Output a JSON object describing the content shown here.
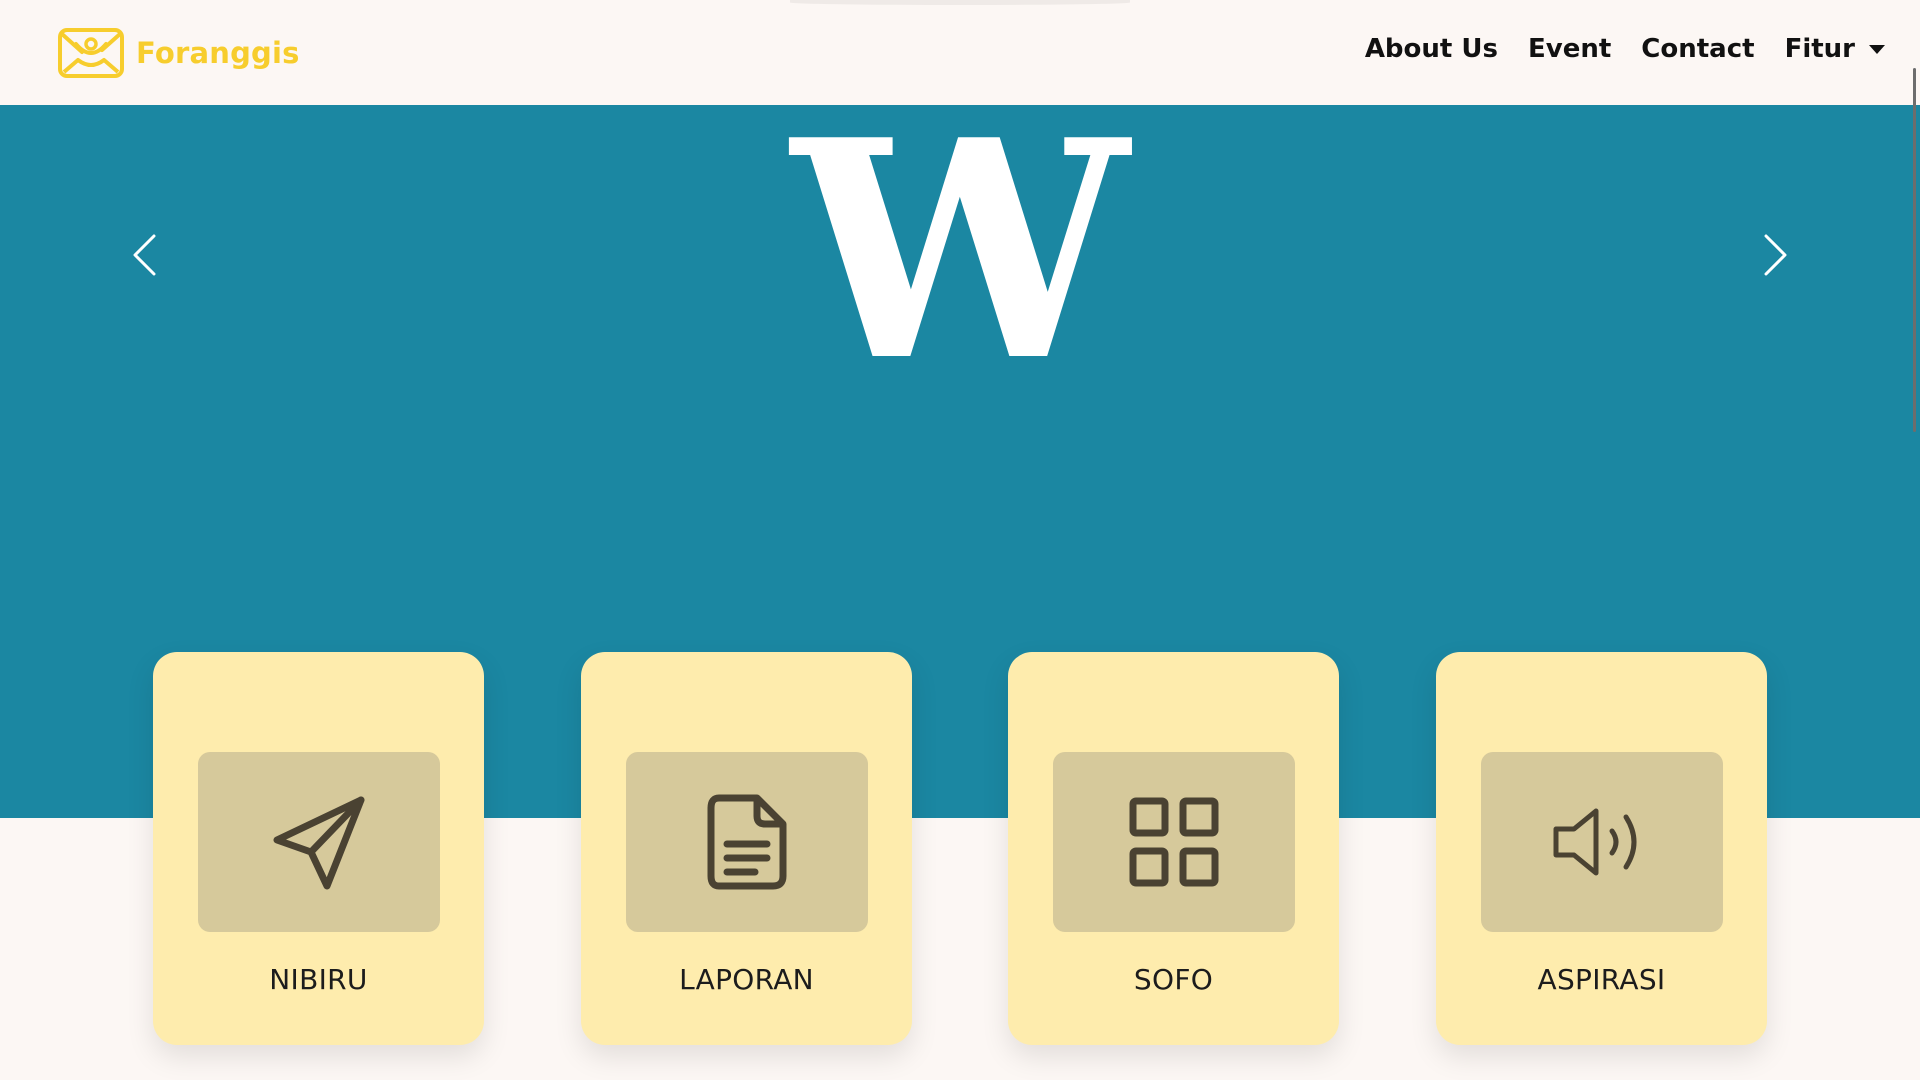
{
  "navbar": {
    "brand_name": "Foranggis",
    "links": [
      {
        "label": "About Us"
      },
      {
        "label": "Event"
      },
      {
        "label": "Contact"
      },
      {
        "label": "Fitur"
      }
    ]
  },
  "hero": {
    "slide_text": "W",
    "prev_icon": "chevron-left-icon",
    "next_icon": "chevron-right-icon"
  },
  "features": [
    {
      "label": "NIBIRU",
      "icon": "send-icon"
    },
    {
      "label": "LAPORAN",
      "icon": "document-icon"
    },
    {
      "label": "SOFO",
      "icon": "grid-icon"
    },
    {
      "label": "ASPIRASI",
      "icon": "speaker-icon"
    }
  ],
  "colors": {
    "brand": "#f7cd2d",
    "hero_background": "#1b87a2",
    "card_background": "#feecad",
    "icon_box": "#d6c99b",
    "icon": "#4a4232",
    "page_background": "#fcf7f4"
  }
}
